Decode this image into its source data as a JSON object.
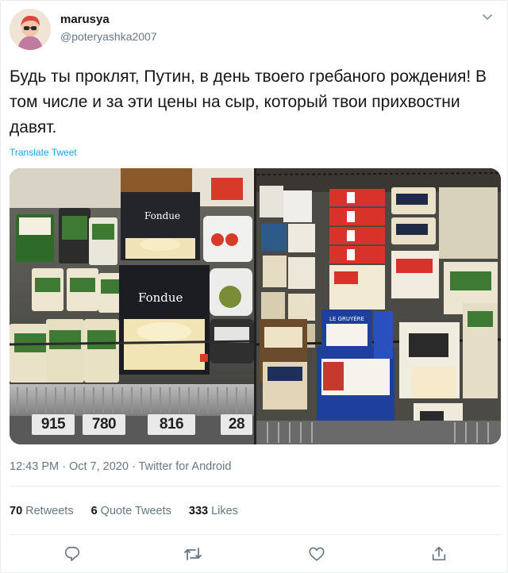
{
  "user": {
    "name": "marusya",
    "handle": "@poteryashka2007"
  },
  "tweet": {
    "text": "Будь ты проклят, Путин, в день твоего гребаного рождения! В том числе и за эти цены на сыр, который твои прихвостни давят.",
    "translate_label": "Translate Tweet"
  },
  "media": {
    "left_photo": {
      "package_label_1": "Fondue",
      "package_label_2": "Fondue",
      "price_tags": [
        "915",
        "780",
        "816",
        "28"
      ]
    },
    "right_photo": {
      "package_label_1": "LE GRUYÈRE"
    }
  },
  "meta": {
    "timestamp": "12:43 PM · Oct 7, 2020 · Twitter for Android"
  },
  "stats": {
    "retweets_count": "70",
    "retweets_label": "Retweets",
    "quotes_count": "6",
    "quotes_label": "Quote Tweets",
    "likes_count": "333",
    "likes_label": "Likes"
  },
  "actions": {
    "icons": [
      "reply-icon",
      "retweet-icon",
      "like-icon",
      "share-icon"
    ]
  },
  "colors": {
    "link": "#1da1f2",
    "secondary_text": "#657786",
    "primary_text": "#14171a",
    "border": "#e6ecf0"
  }
}
